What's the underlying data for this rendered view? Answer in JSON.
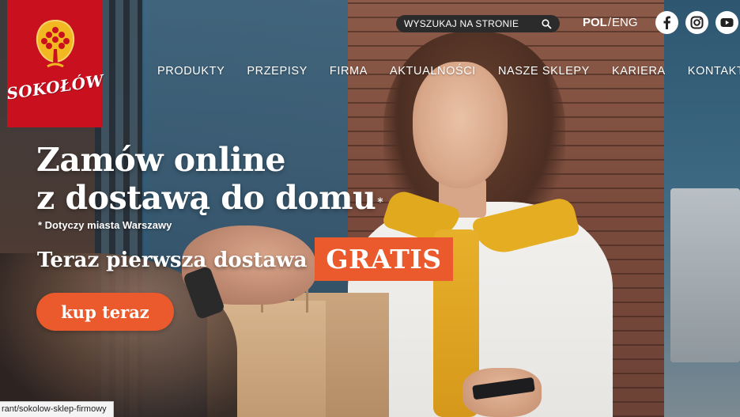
{
  "brand": {
    "name": "SOKOŁÓW",
    "colors": {
      "logo_bg": "#c8101e",
      "accent": "#ea5a2c"
    }
  },
  "search": {
    "placeholder": "WYSZUKAJ NA STRONIE",
    "icon": "search-icon"
  },
  "language": {
    "active": "POL",
    "separator": "/",
    "other": "ENG"
  },
  "social": [
    {
      "name": "facebook",
      "icon": "facebook-icon"
    },
    {
      "name": "instagram",
      "icon": "instagram-icon"
    },
    {
      "name": "youtube",
      "icon": "youtube-icon"
    }
  ],
  "nav": {
    "items": [
      "PRODUKTY",
      "PRZEPISY",
      "FIRMA",
      "AKTUALNOŚCI",
      "NASZE SKLEPY",
      "KARIERA",
      "KONTAKT"
    ]
  },
  "hero": {
    "headline_line1": "Zamów online",
    "headline_line2": "z dostawą do domu",
    "asterisk": "*",
    "note": "* Dotyczy miasta Warszawy",
    "promo": "Teraz pierwsza dostawa",
    "badge": "GRATIS",
    "cta": "kup teraz"
  },
  "status_bar": {
    "url": "rant/sokolow-sklep-firmowy"
  }
}
